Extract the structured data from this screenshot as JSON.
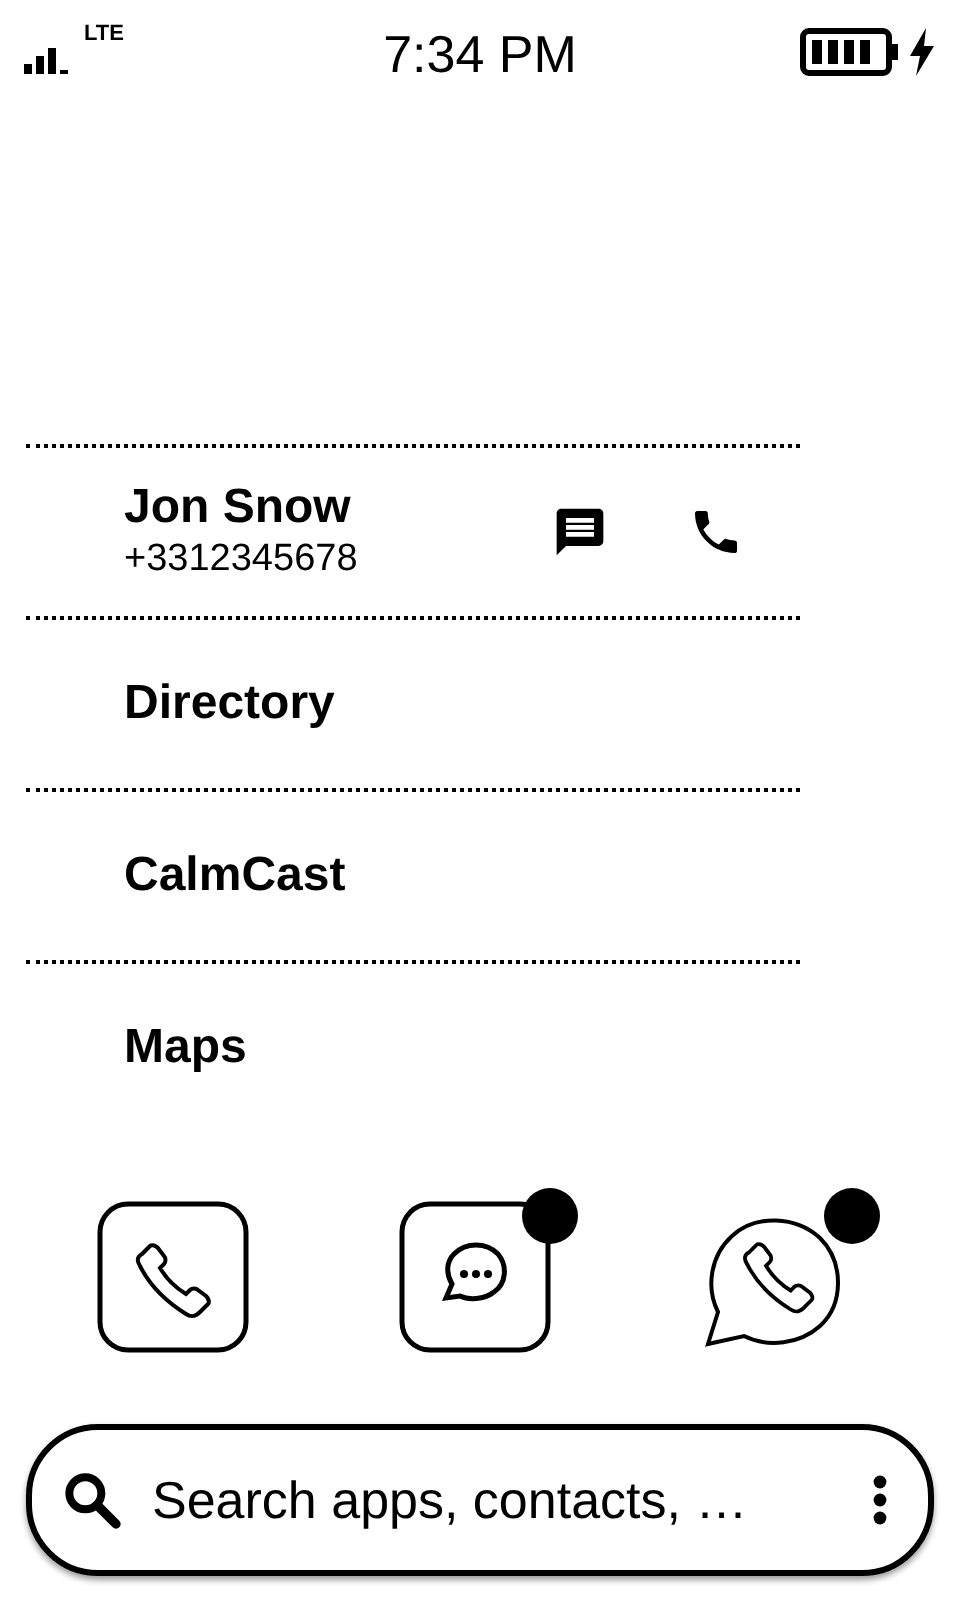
{
  "status_bar": {
    "network": "LTE",
    "time": "7:34 PM",
    "charging": true
  },
  "list": [
    {
      "kind": "contact",
      "name": "Jon Snow",
      "number": "+3312345678"
    },
    {
      "kind": "app",
      "name": "Directory"
    },
    {
      "kind": "app",
      "name": "CalmCast"
    },
    {
      "kind": "app",
      "name": "Maps"
    }
  ],
  "dock": [
    {
      "kind": "phone",
      "notification": false
    },
    {
      "kind": "messages",
      "notification": true
    },
    {
      "kind": "chat-phone",
      "notification": true
    }
  ],
  "search": {
    "placeholder": "Search apps, contacts, …"
  }
}
